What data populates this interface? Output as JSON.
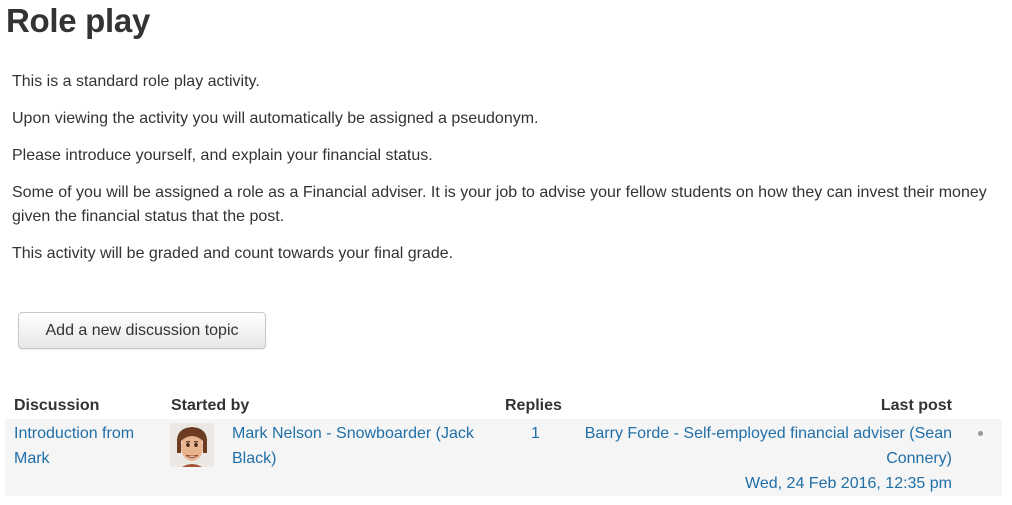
{
  "page": {
    "title": "Role play"
  },
  "intro": {
    "paragraphs": [
      "This is a standard role play activity.",
      "Upon viewing the activity you will automatically be assigned a pseudonym.",
      "Please introduce yourself, and explain your financial status.",
      "Some of you will be assigned a role as a Financial adviser. It is your job to advise your fellow students on how they can invest their money given the financial status that the post.",
      "This activity will be graded and count towards your final grade."
    ]
  },
  "actions": {
    "add_topic_label": "Add a new discussion topic"
  },
  "table": {
    "headers": {
      "discussion": "Discussion",
      "started_by": "Started by",
      "replies": "Replies",
      "last_post": "Last post"
    },
    "rows": [
      {
        "discussion": "Introduction from Mark",
        "started_by": "Mark Nelson - Snowboarder (Jack Black)",
        "avatar_icon": "user-avatar-icon",
        "replies": "1",
        "last_post_author": "Barry Forde - Self-employed financial adviser (Sean Connery)",
        "last_post_date": "Wed, 24 Feb 2016, 12:35 pm"
      }
    ]
  },
  "colors": {
    "link": "#1f6fa8",
    "text": "#333333",
    "row_bg": "#f5f5f5"
  }
}
